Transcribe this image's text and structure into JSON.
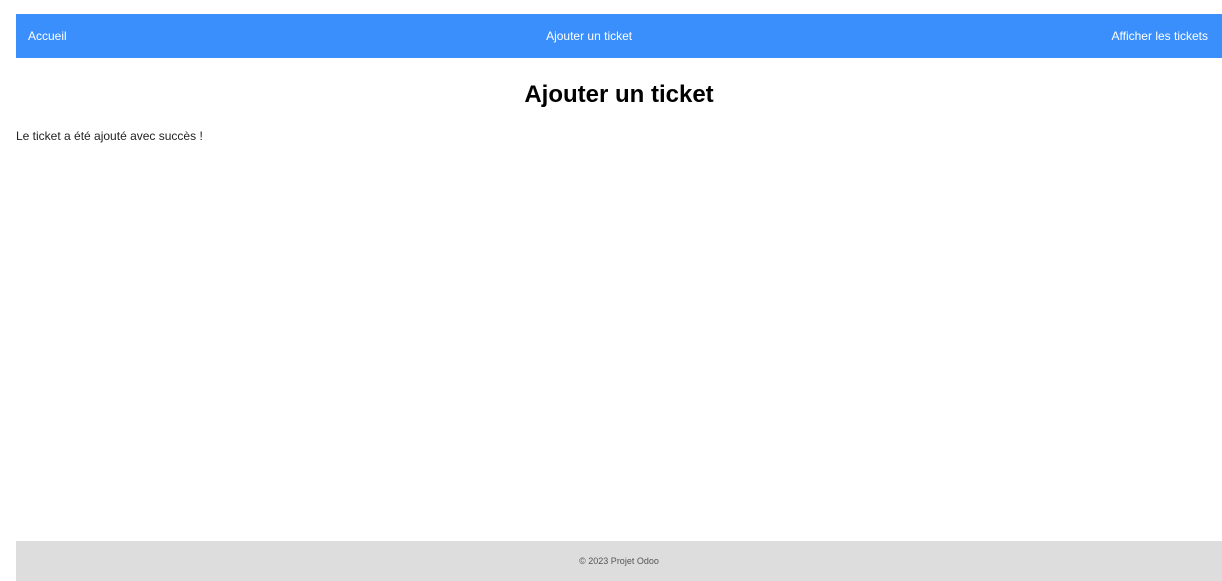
{
  "nav": {
    "home": "Accueil",
    "add_ticket": "Ajouter un ticket",
    "view_tickets": "Afficher les tickets"
  },
  "main": {
    "title": "Ajouter un ticket",
    "success_message": "Le ticket a été ajouté avec succès !"
  },
  "footer": {
    "copyright": "© 2023 Projet Odoo"
  },
  "colors": {
    "navbar": "#3a8ffd",
    "footer": "#dddddd"
  }
}
